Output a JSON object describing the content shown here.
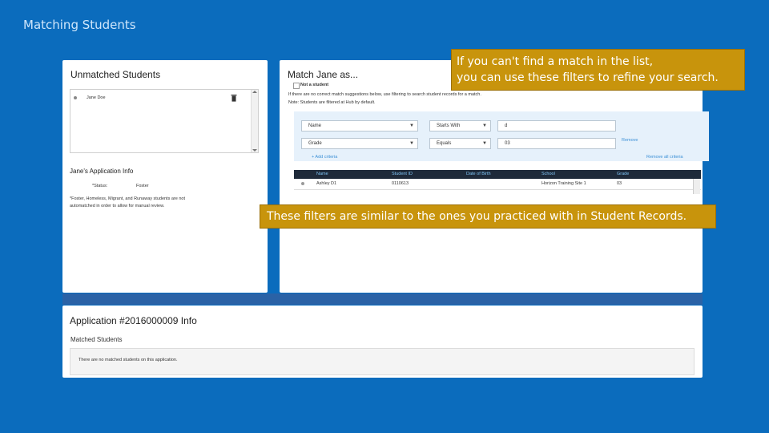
{
  "slide_title": "Matching Students",
  "unmatched": {
    "title": "Unmatched Students",
    "student": "Jane Doe",
    "app_info_title": "Jane's Application Info",
    "status_label": "*Status:",
    "status_value": "Foster",
    "note_line1": "*Foster, Homeless, Migrant, and Runaway students are not",
    "note_line2": "automatched in order to allow for manual review."
  },
  "match": {
    "title": "Match Jane as...",
    "not_student_label": "Not a student",
    "help_line1": "If there are no correct match suggestions below, use filtering to search student records for a match.",
    "help_line2": "Note: Students are filtered at Hub by default.",
    "filters": [
      {
        "field": "Name",
        "operator": "Starts With",
        "value": "d"
      },
      {
        "field": "Grade",
        "operator": "Equals",
        "value": "03"
      }
    ],
    "remove_label": "Remove",
    "add_criteria_label": "+ Add criteria",
    "remove_all_label": "Remove all criteria",
    "table": {
      "headers": [
        "Name",
        "Student ID",
        "Date of Birth",
        "School",
        "Grade"
      ],
      "rows": [
        [
          "Ashley D1",
          "0110613",
          "",
          "Horizon Training Site 1",
          "03"
        ]
      ]
    }
  },
  "application": {
    "title": "Application #2016000009 Info",
    "matched_label": "Matched Students",
    "empty_message": "There are no matched students on this application."
  },
  "callouts": {
    "top_line1": "If you can't find a match in the list,",
    "top_line2": "you can use these filters to refine your search.",
    "bottom": "These filters are similar to the ones you practiced with in Student Records."
  },
  "colors": {
    "background": "#0b6cbd",
    "callout": "#c8940c",
    "table_header": "#1e2a3a",
    "filter_band": "#e6f1fb"
  }
}
